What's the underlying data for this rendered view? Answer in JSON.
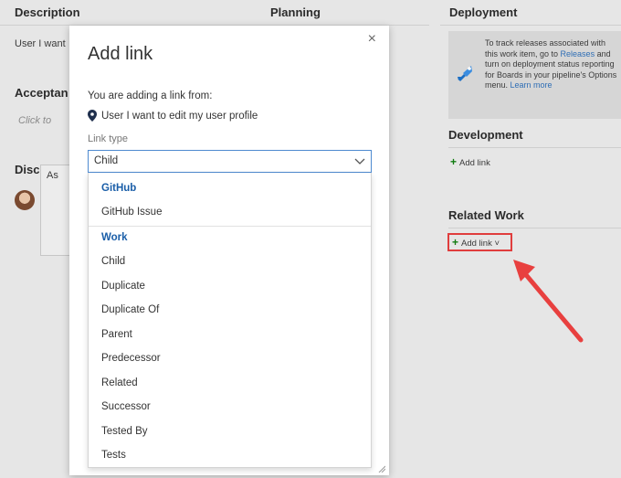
{
  "background": {
    "columns": {
      "description": "Description",
      "planning": "Planning",
      "deployment": "Deployment"
    },
    "description_text": "User I want",
    "acceptance_heading": "Acceptan",
    "acceptance_placeholder": "Click to",
    "discussion_heading": "Discussion",
    "discussion_text": "As",
    "deployment_card": {
      "text_1": "To track releases associated with this work item, go to",
      "link_releases": "Releases",
      "text_2": "and turn on deployment status reporting for Boards in your pipeline's Options menu.",
      "link_learn_more": "Learn more"
    },
    "development_heading": "Development",
    "development_add_link": "Add link",
    "related_work_heading": "Related Work",
    "related_work_add_link": "Add link ˅"
  },
  "dialog": {
    "title": "Add link",
    "close": "×",
    "subtitle": "You are adding a link from:",
    "source_item": "User I want to edit my user profile",
    "link_type_label": "Link type",
    "link_type_value": "Child",
    "dropdown": {
      "groups": [
        {
          "label": "GitHub",
          "items": [
            "GitHub Issue"
          ]
        },
        {
          "label": "Work",
          "items": [
            "Child",
            "Duplicate",
            "Duplicate Of",
            "Parent",
            "Predecessor",
            "Related",
            "Successor",
            "Tested By",
            "Tests"
          ]
        }
      ]
    }
  },
  "colors": {
    "accent": "#1a5ea8",
    "highlight_red": "#e03d3d",
    "add_green": "#107c10"
  }
}
